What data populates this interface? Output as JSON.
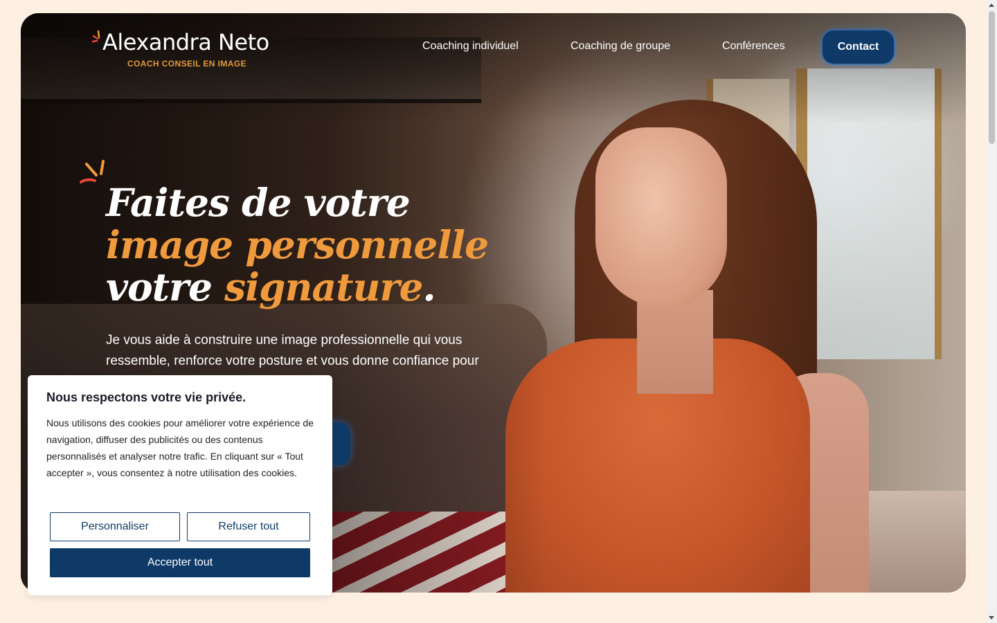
{
  "header": {
    "logo_name": "Alexandra Neto",
    "logo_tagline": "COACH CONSEIL EN IMAGE",
    "nav": [
      {
        "label": "Coaching individuel"
      },
      {
        "label": "Coaching de groupe"
      },
      {
        "label": "Conférences"
      }
    ],
    "contact_label": "Contact"
  },
  "hero": {
    "headline_line1": "Faites de votre",
    "headline_line2": "image personnelle",
    "headline_line3a": "votre ",
    "headline_line3b": "signature",
    "headline_line3c": ".",
    "lead": "Je vous aide à construire une image professionnelle qui vous ressemble, renforce votre posture et vous donne confiance pour oser vous transformer."
  },
  "cookie": {
    "title": "Nous respectons votre vie privée.",
    "text": "Nous utilisons des cookies pour améliorer votre expérience de navigation, diffuser des publicités ou des contenus personnalisés et analyser notre trafic. En cliquant sur « Tout accepter », vous consentez à notre utilisation des cookies.",
    "customize_label": "Personnaliser",
    "reject_label": "Refuser tout",
    "accept_label": "Accepter tout"
  },
  "colors": {
    "page_bg": "#fdf0e3",
    "accent_orange": "#ef9a3d",
    "brand_navy": "#0f3a67"
  },
  "icons": {
    "logo_spark": "spark-icon",
    "hero_spark": "spark-icon"
  }
}
